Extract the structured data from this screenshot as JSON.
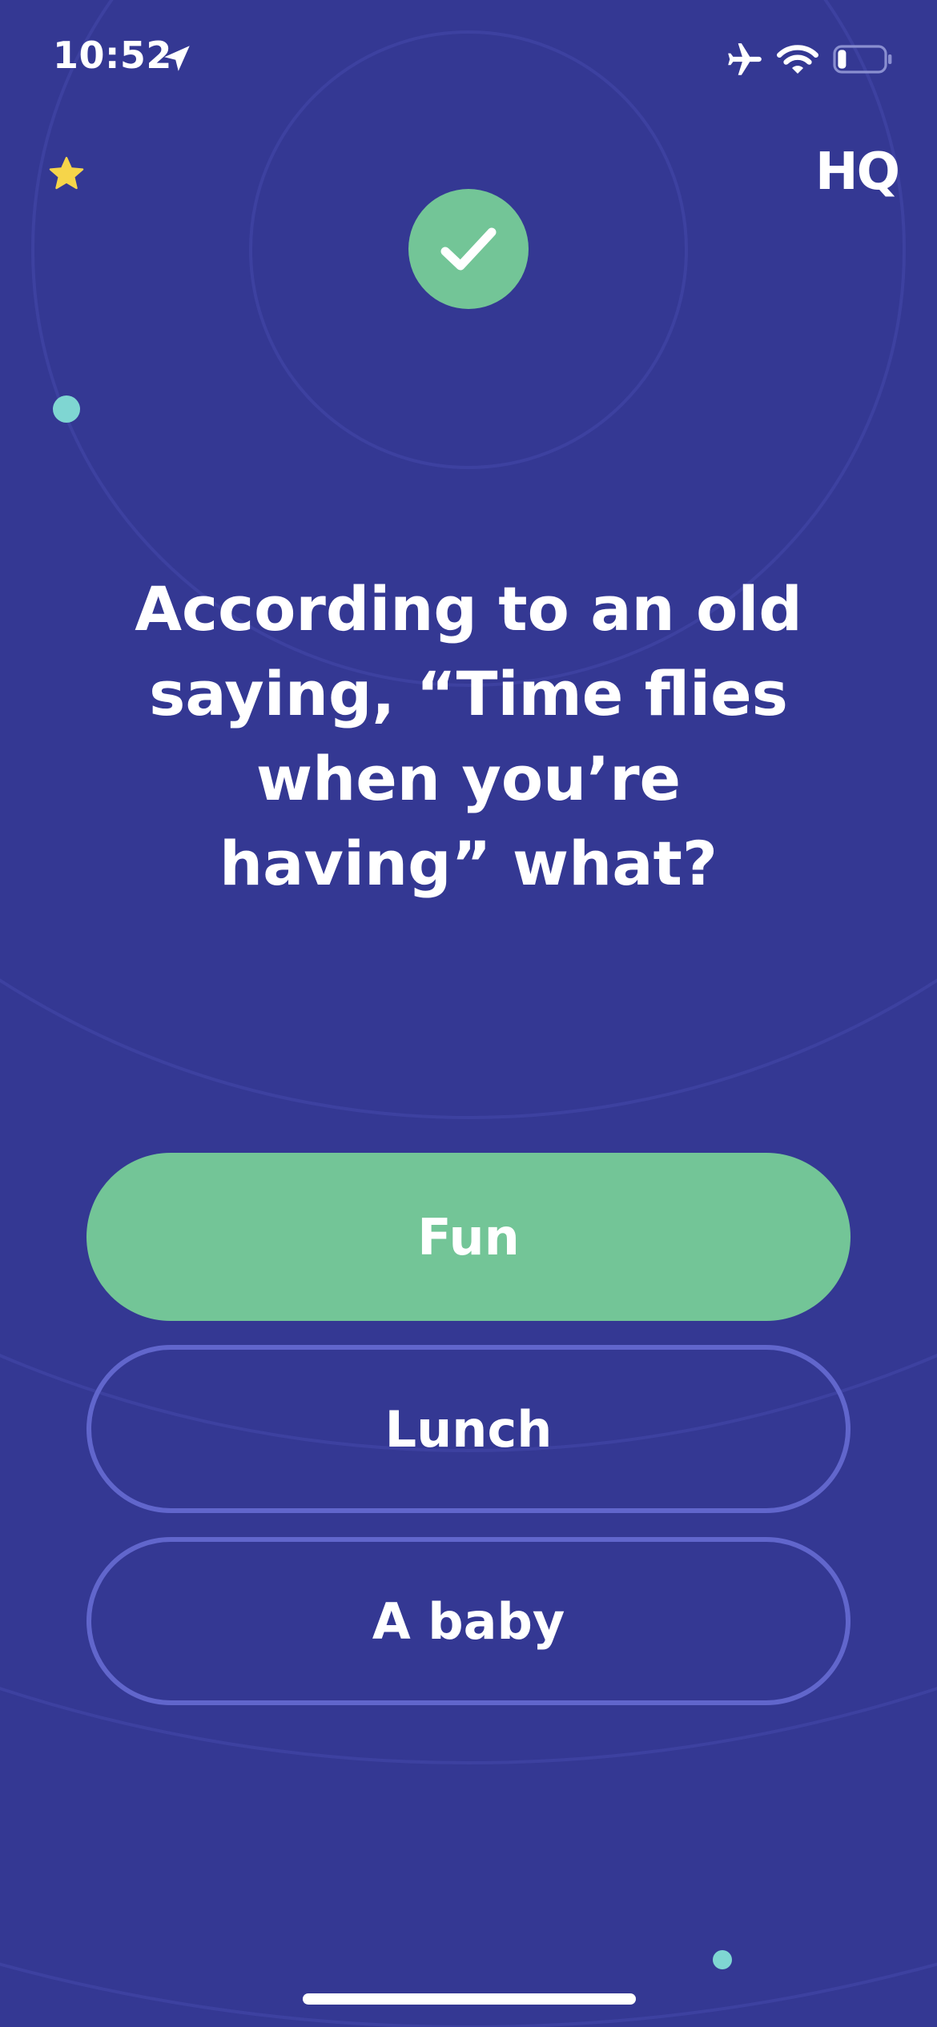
{
  "status_bar": {
    "time": "10:52",
    "icons": [
      "location-arrow-icon",
      "airplane-mode-icon",
      "wifi-icon",
      "battery-icon"
    ]
  },
  "header": {
    "logo": "HQ",
    "star_icon": "star-icon",
    "result_icon": "checkmark-icon"
  },
  "question": {
    "text": "According to an old saying, “Time flies when you’re having” what?"
  },
  "answers": [
    {
      "label": "Fun",
      "state": "correct"
    },
    {
      "label": "Lunch",
      "state": "default"
    },
    {
      "label": "A baby",
      "state": "default"
    }
  ],
  "colors": {
    "background": "#343893",
    "correct": "#73c597",
    "answer_border": "#6166cc",
    "star": "#f6d54a",
    "accent_dot": "#7fd6d2"
  }
}
